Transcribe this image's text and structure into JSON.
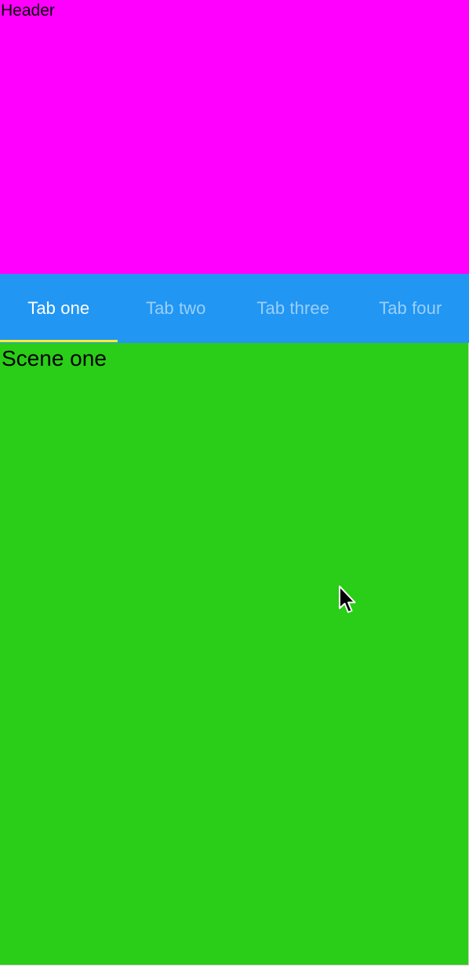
{
  "header": {
    "title": "Header",
    "color": "#ff00ff"
  },
  "tabs": {
    "background": "#2196f3",
    "indicator_color": "#ffeb3b",
    "active_index": 0,
    "items": [
      {
        "label": "Tab one"
      },
      {
        "label": "Tab two"
      },
      {
        "label": "Tab three"
      },
      {
        "label": "Tab four"
      }
    ]
  },
  "scene": {
    "title": "Scene one",
    "color": "#2acd17"
  },
  "cursor": {
    "icon": "arrow-pointer-icon"
  }
}
